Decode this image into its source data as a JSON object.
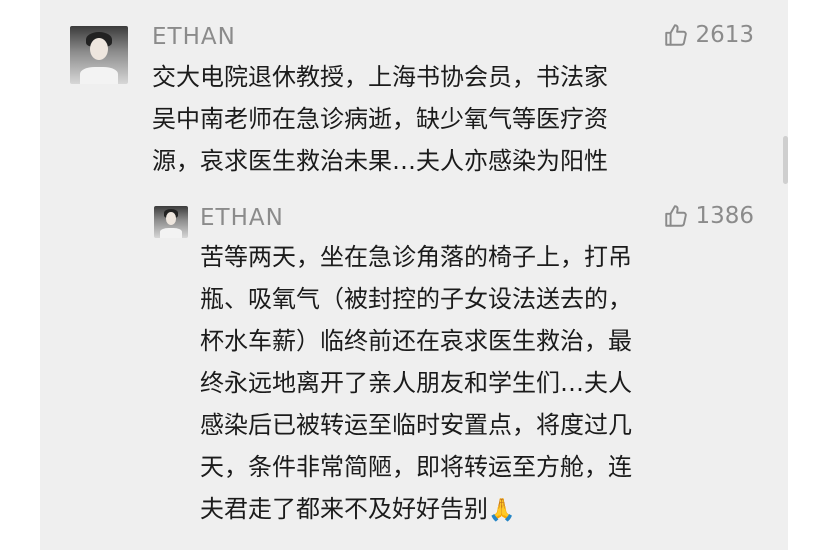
{
  "comments": [
    {
      "user": "ETHAN",
      "likes": "2613",
      "text": "交大电院退休教授，上海书协会员，书法家\n吴中南老师在急诊病逝，缺少氧气等医疗资\n源，哀求医生救治未果…夫人亦感染为阳性"
    }
  ],
  "replies": [
    {
      "user": "ETHAN",
      "likes": "1386",
      "text": "苦等两天，坐在急诊角落的椅子上，打吊\n瓶、吸氧气（被封控的子女设法送去的，\n杯水车薪）临终前还在哀求医生救治，最\n终永远地离开了亲人朋友和学生们…夫人\n感染后已被转运至临时安置点，将度过几\n天，条件非常简陋，即将转运至方舱，连\n夫君走了都来不及好好告别",
      "emoji": "🙏"
    }
  ],
  "icons": {
    "like": "thumbs-up-icon",
    "avatar": "user-avatar"
  },
  "colors": {
    "panel": "#efefef",
    "meta": "#8b8b8b",
    "text": "#1b1b1b"
  }
}
